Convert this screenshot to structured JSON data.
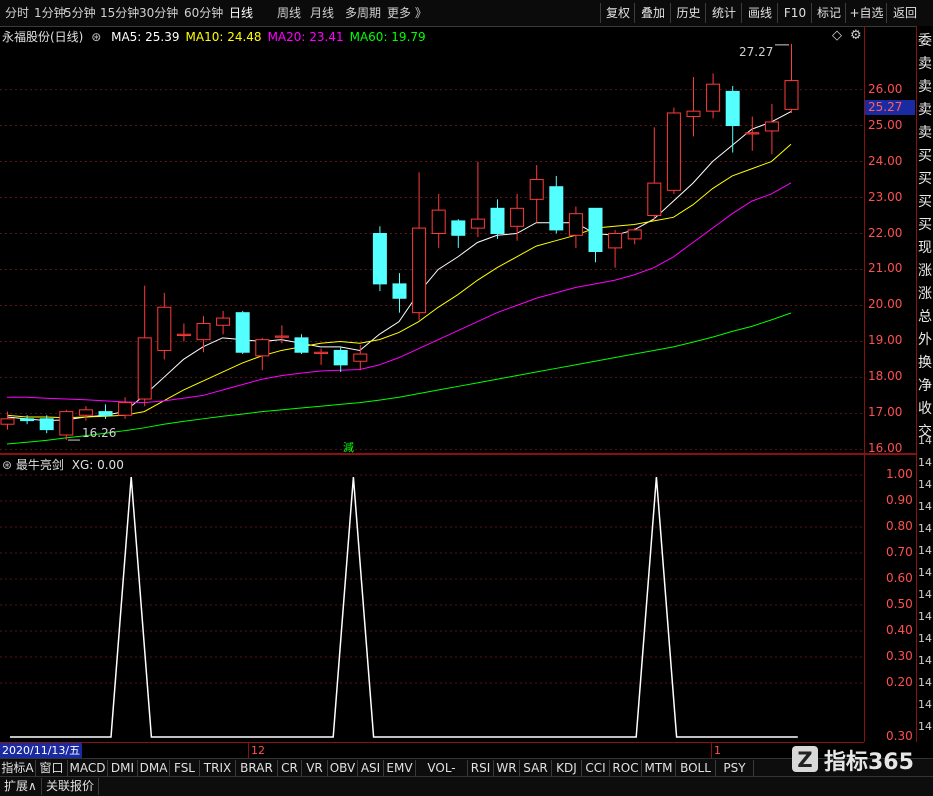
{
  "toolbar": {
    "periods": [
      "分时",
      "1分钟",
      "5分钟",
      "15分钟",
      "30分钟",
      "60分钟",
      "日线",
      "周线",
      "月线",
      "多周期",
      "更多 》"
    ],
    "active_period": "日线",
    "buttons": [
      "复权",
      "叠加",
      "历史",
      "统计",
      "画线",
      "F10",
      "标记",
      "+自选",
      "返回"
    ]
  },
  "main_chart": {
    "stock_title": "永福股份(日线)",
    "ma_legend": [
      {
        "label": "MA5: 25.39",
        "color": "#ffffff"
      },
      {
        "label": "MA10: 24.48",
        "color": "#ffff00"
      },
      {
        "label": "MA20: 23.41",
        "color": "#ff00ff"
      },
      {
        "label": "MA60: 19.79",
        "color": "#00ff00"
      }
    ],
    "high_label": "27.27",
    "low_label": "16.26",
    "current_price": "25.27",
    "price_ticks": [
      "26.00",
      "25.00",
      "24.00",
      "23.00",
      "22.00",
      "21.00",
      "20.00",
      "19.00",
      "18.00",
      "17.00",
      "16.00"
    ],
    "bottom_marker": "減",
    "icons": [
      "diamond-icon",
      "settings-icon"
    ]
  },
  "sub_chart": {
    "indicator_title": "最牛亮剑",
    "value_label": "XG: 0.00",
    "ticks": [
      "1.00",
      "0.90",
      "0.80",
      "0.70",
      "0.60",
      "0.50",
      "0.40",
      "0.30",
      "0.20",
      "0.30"
    ]
  },
  "right_strip": {
    "labels": [
      "委",
      "卖",
      "卖",
      "卖",
      "卖",
      "买",
      "买",
      "买",
      "买",
      "现",
      "涨",
      "涨",
      "总",
      "外",
      "换",
      "净",
      "收",
      "交",
      "14",
      "14",
      "14",
      "14",
      "14",
      "14",
      "14",
      "14",
      "14",
      "14",
      "14",
      "14",
      "14",
      "14"
    ]
  },
  "date_axis": {
    "start_date": "2020/11/13/五",
    "month_markers": [
      "12",
      "1"
    ]
  },
  "indicators": [
    "指标A",
    "窗口",
    "MACD",
    "DMI",
    "DMA",
    "FSL",
    "TRIX",
    "BRAR",
    "CR",
    "VR",
    "OBV",
    "ASI",
    "EMV",
    "VOL-TDX",
    "RSI",
    "WR",
    "SAR",
    "KDJ",
    "CCI",
    "ROC",
    "MTM",
    "BOLL",
    "PSY B-"
  ],
  "extension_tabs": [
    "扩展∧",
    "关联报价"
  ],
  "logo": {
    "text": "指标365",
    "mark": "Z"
  },
  "chart_data": [
    {
      "type": "candlestick",
      "title": "永福股份(日线)",
      "ylim": [
        15.9,
        27.6
      ],
      "candles": [
        {
          "o": 16.7,
          "h": 17.05,
          "l": 16.55,
          "c": 16.85
        },
        {
          "o": 16.85,
          "h": 16.95,
          "l": 16.7,
          "c": 16.8
        },
        {
          "o": 16.85,
          "h": 16.95,
          "l": 16.45,
          "c": 16.55
        },
        {
          "o": 16.4,
          "h": 17.1,
          "l": 16.26,
          "c": 17.05
        },
        {
          "o": 16.95,
          "h": 17.2,
          "l": 16.8,
          "c": 17.1
        },
        {
          "o": 17.05,
          "h": 17.25,
          "l": 16.85,
          "c": 16.95
        },
        {
          "o": 16.95,
          "h": 17.45,
          "l": 16.85,
          "c": 17.3
        },
        {
          "o": 17.4,
          "h": 20.55,
          "l": 17.2,
          "c": 19.1
        },
        {
          "o": 18.75,
          "h": 20.35,
          "l": 18.5,
          "c": 19.95
        },
        {
          "o": 19.2,
          "h": 19.5,
          "l": 19.0,
          "c": 19.2
        },
        {
          "o": 19.05,
          "h": 19.7,
          "l": 18.7,
          "c": 19.5
        },
        {
          "o": 19.45,
          "h": 19.85,
          "l": 19.2,
          "c": 19.65
        },
        {
          "o": 19.8,
          "h": 19.85,
          "l": 18.65,
          "c": 18.7
        },
        {
          "o": 18.6,
          "h": 19.1,
          "l": 18.2,
          "c": 19.05
        },
        {
          "o": 19.15,
          "h": 19.45,
          "l": 18.95,
          "c": 19.15
        },
        {
          "o": 19.1,
          "h": 19.2,
          "l": 18.65,
          "c": 18.7
        },
        {
          "o": 18.7,
          "h": 18.8,
          "l": 18.35,
          "c": 18.7
        },
        {
          "o": 18.75,
          "h": 18.85,
          "l": 18.15,
          "c": 18.35
        },
        {
          "o": 18.45,
          "h": 18.9,
          "l": 18.2,
          "c": 18.65
        },
        {
          "o": 22.0,
          "h": 22.2,
          "l": 20.4,
          "c": 20.6
        },
        {
          "o": 20.6,
          "h": 20.9,
          "l": 19.8,
          "c": 20.2
        },
        {
          "o": 19.8,
          "h": 23.7,
          "l": 19.6,
          "c": 22.15
        },
        {
          "o": 22.0,
          "h": 23.1,
          "l": 21.6,
          "c": 22.65
        },
        {
          "o": 22.35,
          "h": 22.4,
          "l": 21.6,
          "c": 21.95
        },
        {
          "o": 22.15,
          "h": 24.0,
          "l": 21.9,
          "c": 22.4
        },
        {
          "o": 22.7,
          "h": 22.95,
          "l": 21.85,
          "c": 22.0
        },
        {
          "o": 22.2,
          "h": 23.1,
          "l": 21.8,
          "c": 22.7
        },
        {
          "o": 22.95,
          "h": 23.9,
          "l": 22.3,
          "c": 23.5
        },
        {
          "o": 23.3,
          "h": 23.6,
          "l": 22.0,
          "c": 22.1
        },
        {
          "o": 21.95,
          "h": 22.75,
          "l": 21.6,
          "c": 22.55
        },
        {
          "o": 22.7,
          "h": 22.7,
          "l": 21.2,
          "c": 21.5
        },
        {
          "o": 21.6,
          "h": 22.1,
          "l": 21.05,
          "c": 22.0
        },
        {
          "o": 21.85,
          "h": 22.15,
          "l": 21.7,
          "c": 22.1
        },
        {
          "o": 22.5,
          "h": 24.95,
          "l": 22.4,
          "c": 23.4
        },
        {
          "o": 23.2,
          "h": 25.5,
          "l": 23.1,
          "c": 25.35
        },
        {
          "o": 25.25,
          "h": 26.35,
          "l": 24.7,
          "c": 25.4
        },
        {
          "o": 25.4,
          "h": 26.45,
          "l": 25.2,
          "c": 26.15
        },
        {
          "o": 25.95,
          "h": 26.1,
          "l": 24.25,
          "c": 25.0
        },
        {
          "o": 24.8,
          "h": 25.25,
          "l": 24.3,
          "c": 24.8
        },
        {
          "o": 24.85,
          "h": 25.6,
          "l": 24.2,
          "c": 25.1
        },
        {
          "o": 25.45,
          "h": 27.27,
          "l": 25.35,
          "c": 26.25
        }
      ],
      "ma": {
        "MA5": [
          16.9,
          16.85,
          16.8,
          16.82,
          16.9,
          16.95,
          17.05,
          17.5,
          18.0,
          18.5,
          18.85,
          19.1,
          19.05,
          19.0,
          19.05,
          18.95,
          18.85,
          18.85,
          18.75,
          19.2,
          19.55,
          20.35,
          21.0,
          21.35,
          21.75,
          21.95,
          22.0,
          22.3,
          22.3,
          22.3,
          22.0,
          21.95,
          22.1,
          22.4,
          22.9,
          23.4,
          24.0,
          24.45,
          24.9,
          25.1,
          25.39
        ],
        "MA10": [
          16.95,
          16.9,
          16.9,
          16.88,
          16.9,
          16.92,
          16.95,
          17.05,
          17.35,
          17.65,
          17.9,
          18.15,
          18.4,
          18.6,
          18.75,
          18.85,
          18.95,
          19.0,
          18.95,
          19.05,
          19.25,
          19.55,
          19.95,
          20.3,
          20.7,
          21.05,
          21.35,
          21.65,
          21.8,
          21.95,
          22.15,
          22.2,
          22.25,
          22.35,
          22.45,
          22.8,
          23.25,
          23.6,
          23.8,
          24.0,
          24.48
        ],
        "MA20": [
          17.45,
          17.45,
          17.42,
          17.4,
          17.38,
          17.35,
          17.32,
          17.3,
          17.35,
          17.42,
          17.5,
          17.65,
          17.8,
          17.95,
          18.05,
          18.12,
          18.18,
          18.2,
          18.22,
          18.35,
          18.55,
          18.8,
          19.05,
          19.3,
          19.55,
          19.8,
          20.0,
          20.2,
          20.35,
          20.5,
          20.6,
          20.7,
          20.85,
          21.05,
          21.35,
          21.75,
          22.15,
          22.55,
          22.9,
          23.1,
          23.41
        ],
        "MA60": [
          16.15,
          16.2,
          16.25,
          16.32,
          16.38,
          16.45,
          16.52,
          16.6,
          16.7,
          16.78,
          16.85,
          16.92,
          16.98,
          17.05,
          17.1,
          17.15,
          17.2,
          17.25,
          17.3,
          17.37,
          17.45,
          17.55,
          17.65,
          17.75,
          17.85,
          17.95,
          18.05,
          18.15,
          18.25,
          18.35,
          18.45,
          18.55,
          18.65,
          18.75,
          18.85,
          18.98,
          19.12,
          19.28,
          19.42,
          19.6,
          19.79
        ]
      }
    },
    {
      "type": "line",
      "title": "最牛亮剑",
      "series": [
        {
          "name": "XG",
          "values": [
            0,
            0,
            0,
            0,
            0,
            0,
            1,
            0,
            0,
            0,
            0,
            0,
            0,
            0,
            0,
            0,
            0,
            1,
            0,
            0,
            0,
            0,
            0,
            0,
            0,
            0,
            0,
            0,
            0,
            0,
            0,
            0,
            1,
            0,
            0,
            0,
            0,
            0,
            0,
            0
          ]
        }
      ],
      "ylim": [
        0,
        1
      ]
    }
  ]
}
